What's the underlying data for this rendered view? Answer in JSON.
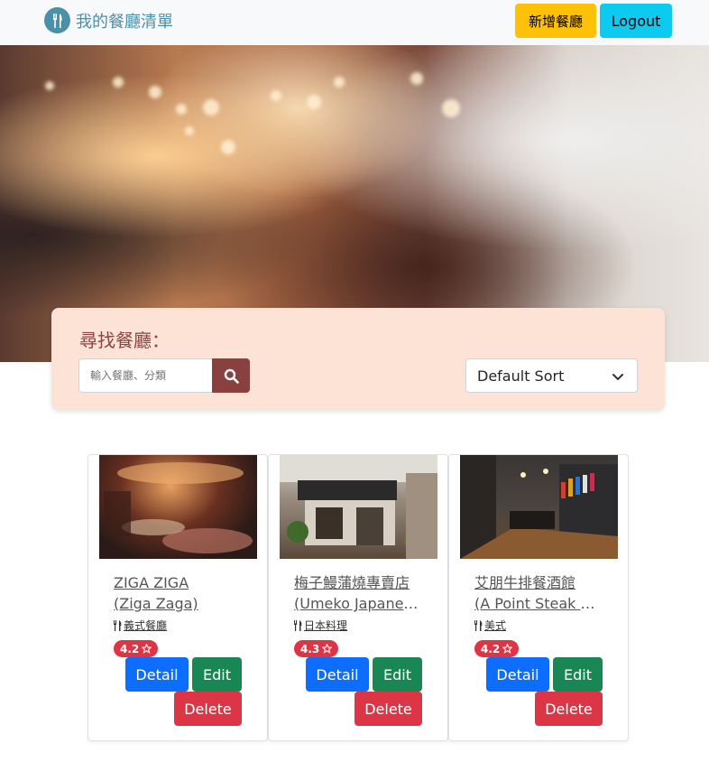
{
  "navbar": {
    "brand_title": "我的餐廳清單",
    "brand_icon": "utensils-icon",
    "new_button": "新增餐廳",
    "logout_button": "Logout"
  },
  "search": {
    "label": "尋找餐廳：",
    "placeholder": "輸入餐廳、分類",
    "button_icon": "search-icon",
    "sort_selected": "Default Sort"
  },
  "restaurants": [
    {
      "name_line1": "ZIGA ZIGA",
      "name_line2": "(Ziga Zaga)",
      "category": "義式餐廳",
      "rating": "4.2",
      "detail": "Detail",
      "edit": "Edit",
      "delete": "Delete"
    },
    {
      "name_line1": "梅子鰻蒲燒專賣店",
      "name_line2": "(Umeko Japanese...",
      "category": "日本料理",
      "rating": "4.3",
      "detail": "Detail",
      "edit": "Edit",
      "delete": "Delete"
    },
    {
      "name_line1": "艾朋牛排餐酒館",
      "name_line2": "(A Point Steak & ...",
      "category": "美式",
      "rating": "4.2",
      "detail": "Detail",
      "edit": "Edit",
      "delete": "Delete"
    }
  ],
  "colors": {
    "navbar_bg": "#f8f9fa",
    "brand": "#4a90a8",
    "warning": "#ffc107",
    "info": "#0dcaf0",
    "search_panel": "#fde2d6",
    "search_label": "#8b4444",
    "search_button": "#8b4040",
    "primary": "#0d6efd",
    "success": "#198754",
    "danger": "#dc3545"
  }
}
